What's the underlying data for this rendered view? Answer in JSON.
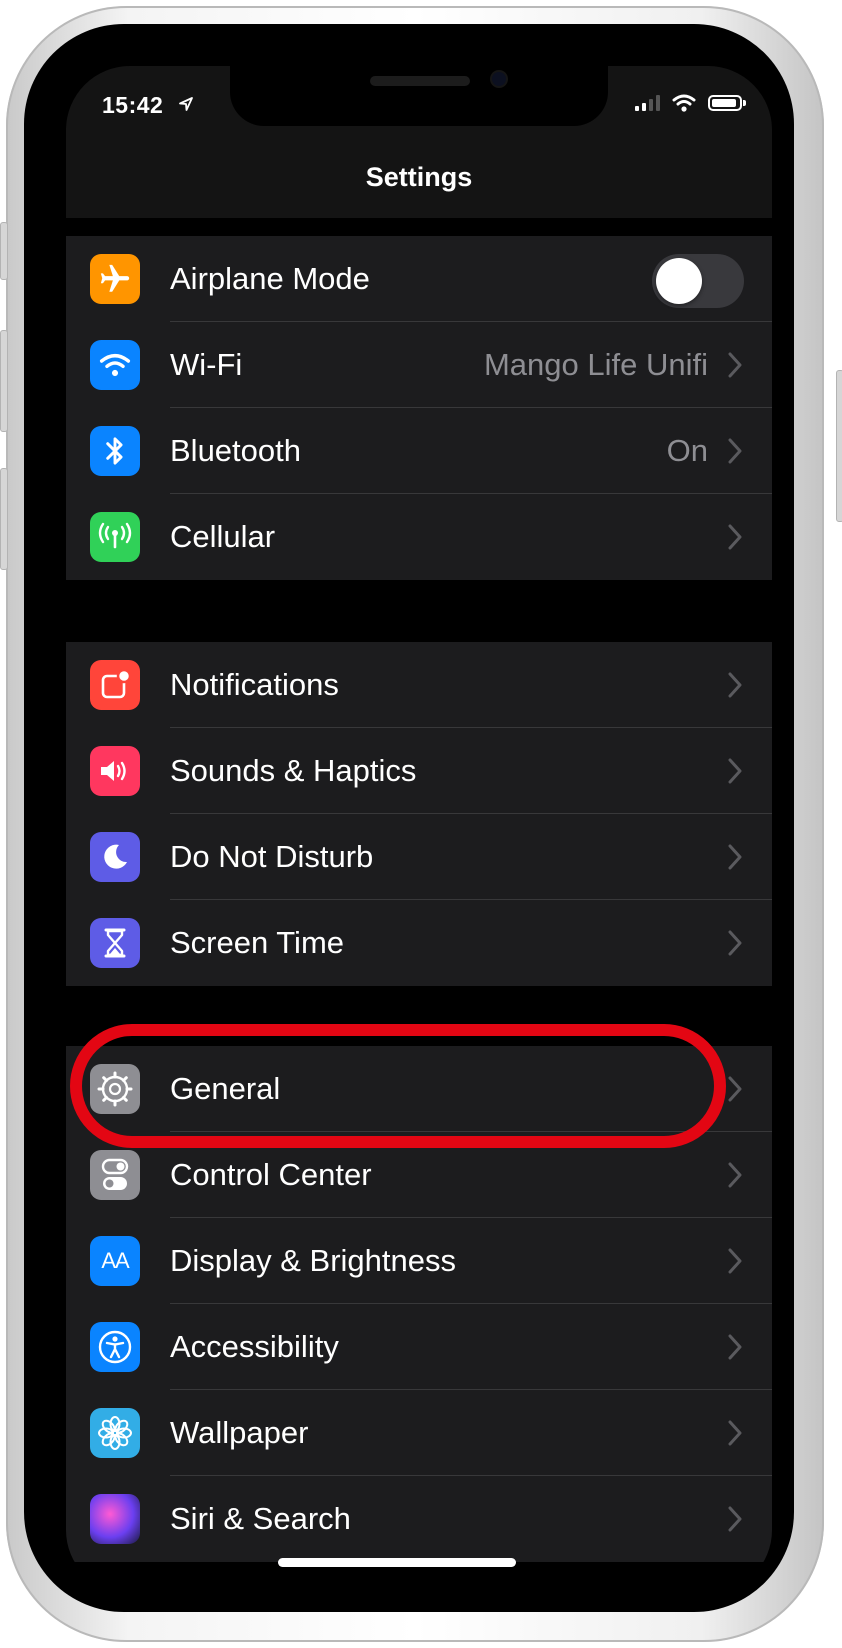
{
  "status_bar": {
    "time": "15:42"
  },
  "nav": {
    "title": "Settings"
  },
  "groups": [
    {
      "rows": [
        {
          "label": "Airplane Mode",
          "value": "",
          "icon": "airplane-icon",
          "color": "#ff9500",
          "toggle_on": false
        },
        {
          "label": "Wi-Fi",
          "value": "Mango Life Unifi",
          "icon": "wifi-icon",
          "color": "#0a84ff"
        },
        {
          "label": "Bluetooth",
          "value": "On",
          "icon": "bluetooth-icon",
          "color": "#0a84ff"
        },
        {
          "label": "Cellular",
          "value": "",
          "icon": "cellular-icon",
          "color": "#30d158"
        }
      ]
    },
    {
      "rows": [
        {
          "label": "Notifications",
          "icon": "notifications-icon",
          "color": "#ff453a"
        },
        {
          "label": "Sounds & Haptics",
          "icon": "speaker-icon",
          "color": "#ff375f"
        },
        {
          "label": "Do Not Disturb",
          "icon": "moon-icon",
          "color": "#5e5ce6"
        },
        {
          "label": "Screen Time",
          "icon": "hourglass-icon",
          "color": "#5e5ce6"
        }
      ]
    },
    {
      "rows": [
        {
          "label": "General",
          "icon": "gear-icon",
          "color": "#8e8e93"
        },
        {
          "label": "Control Center",
          "icon": "switches-icon",
          "color": "#8e8e93"
        },
        {
          "label": "Display & Brightness",
          "icon": "text-size-icon",
          "icon_text": "AA",
          "color": "#0a84ff"
        },
        {
          "label": "Accessibility",
          "icon": "accessibility-icon",
          "color": "#0a84ff"
        },
        {
          "label": "Wallpaper",
          "icon": "flower-icon",
          "color": "#32ade6"
        },
        {
          "label": "Siri & Search",
          "icon": "siri-icon",
          "color": "#3a3a3c"
        }
      ]
    }
  ],
  "annotation": {
    "color": "#e30613",
    "target": "General"
  }
}
